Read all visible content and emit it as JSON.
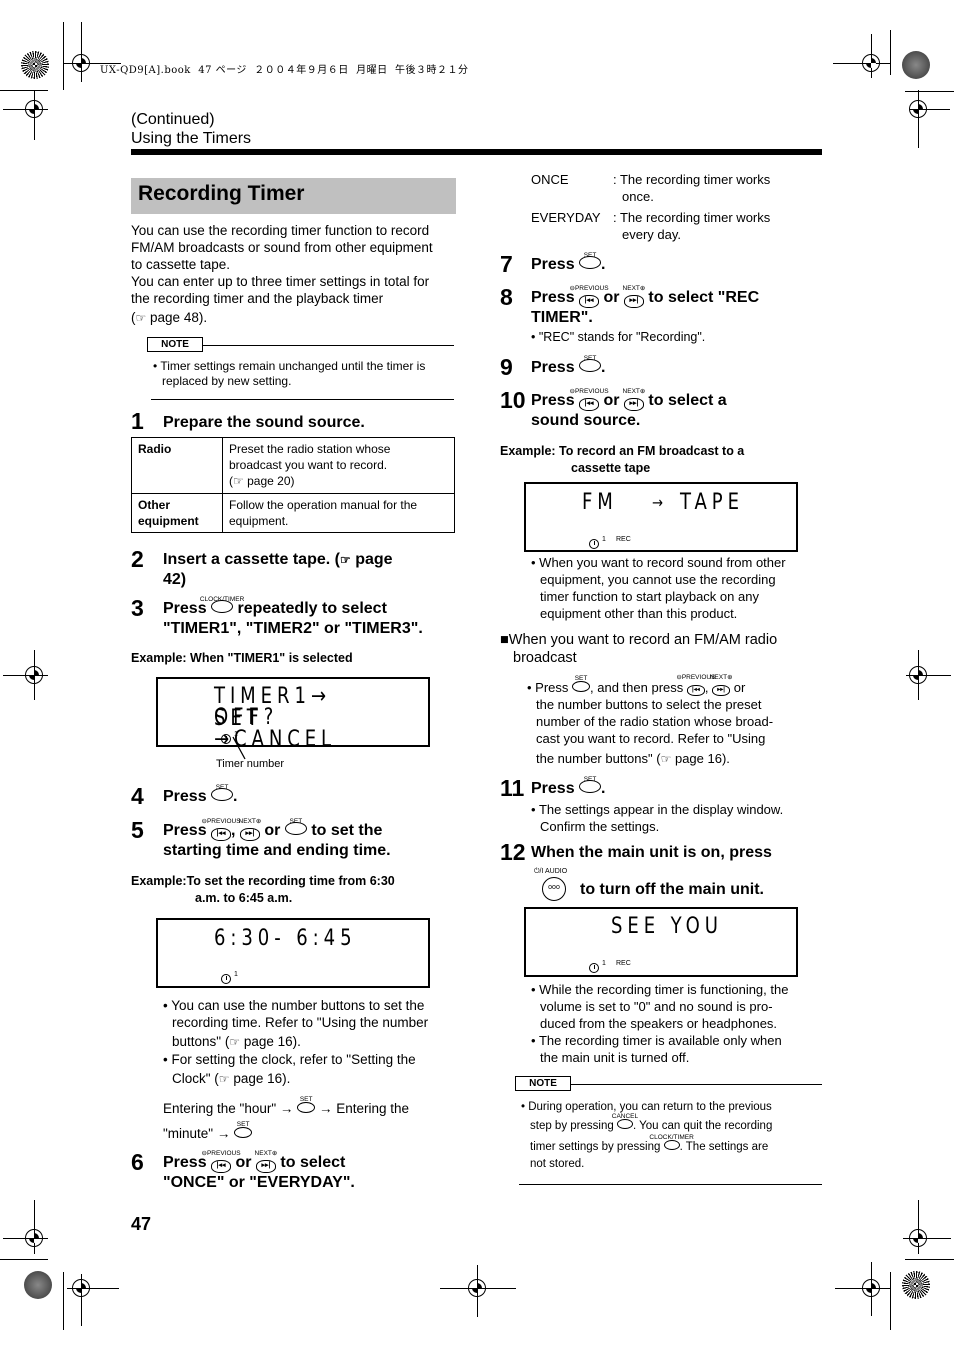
{
  "print_header": "UX-QD9[A].book  47 ページ  ２００４年９月６日  月曜日  午後３時２１分",
  "breadcrumb": {
    "continued": "(Continued)",
    "section": "Using the Timers"
  },
  "section_title": "Recording Timer",
  "intro": {
    "line1": "You can use the recording timer function to record",
    "line2": "FM/AM broadcasts or sound from other equipment",
    "line3": "to cassette tape.",
    "line4": "You can enter up to three timer settings in total for",
    "line5": "the recording timer and the playback timer",
    "ref": "page 48)."
  },
  "note1": {
    "label": "NOTE",
    "line1": "Timer settings remain unchanged until the timer is",
    "line2": "replaced by new setting."
  },
  "icons": {
    "ref": "☞",
    "bullet": "•",
    "arrow": "→",
    "square": "■",
    "prev": "|◂◂",
    "next": "▸▸|"
  },
  "buttons": {
    "set": "SET",
    "clock_timer": "CLOCK/TIMER",
    "previous": "⊖PREVIOUS",
    "next": "NEXT⊕",
    "cancel": "CANCEL",
    "audio": "⏻/I AUDIO"
  },
  "steps": {
    "s1": {
      "num": "1",
      "text": "Prepare the sound source."
    },
    "s2": {
      "num": "2",
      "text": "Insert a cassette tape. (",
      "ref": "page",
      "text2": "42)"
    },
    "s3": {
      "num": "3",
      "press": "Press",
      "text": "repeatedly to select",
      "text2": "\"TIMER1\", \"TIMER2\" or \"TIMER3\"."
    },
    "s4": {
      "num": "4",
      "press": "Press",
      "end": "."
    },
    "s5": {
      "num": "5",
      "press": "Press",
      "comma": ",",
      "or": "or",
      "text": "to set the",
      "text2": "starting time and ending time."
    },
    "s6": {
      "num": "6",
      "press": "Press",
      "or": "or",
      "text": "to select",
      "text2": "\"ONCE\" or \"EVERYDAY\"."
    },
    "s7": {
      "num": "7",
      "press": "Press",
      "end": "."
    },
    "s8": {
      "num": "8",
      "press": "Press",
      "or": "or",
      "text": "to select \"REC",
      "text2": "TIMER\".",
      "note": "\"REC\" stands for \"Recording\"."
    },
    "s9": {
      "num": "9",
      "press": "Press",
      "end": "."
    },
    "s10": {
      "num": "10",
      "press": "Press",
      "or": "or",
      "text": "to select a",
      "text2": "sound source."
    },
    "s11": {
      "num": "11",
      "press": "Press",
      "end": ".",
      "note1": "The settings appear in the display window.",
      "note2": "Confirm the settings."
    },
    "s12": {
      "num": "12",
      "text": "When the main unit is on, press",
      "text2": "to turn off the main unit."
    }
  },
  "source_table": {
    "rows": [
      {
        "label": "Radio",
        "desc1": "Preset the radio station whose",
        "desc2": "broadcast you want to record.",
        "ref": "page 20)"
      },
      {
        "label1": "Other",
        "label2": "equipment",
        "desc1": "Follow the operation manual for the",
        "desc2": "equipment."
      }
    ]
  },
  "example1": {
    "caption": "Example: When \"TIMER1\" is selected",
    "lcd_line1": "TIMER1→ SET",
    "lcd_line2": "OFF?→CANCEL",
    "timer_num": "1",
    "callout": "Timer number"
  },
  "example2": {
    "caption1": "Example:To set the recording time from 6:30",
    "caption2": "a.m. to 6:45 a.m.",
    "lcd_line1": "6:30- 6:45",
    "timer_num": "1"
  },
  "tips5": {
    "b1_l1": "You can use the number buttons to set the",
    "b1_l2": "recording time. Refer to \"Using the number",
    "b1_l3": "buttons\" (",
    "b1_ref": "page 16).",
    "b2_l1": "For setting the clock, refer to \"Setting the",
    "b2_l2": "Clock\" (",
    "b2_ref": "page 16).",
    "flow1": "Entering the \"hour\" →",
    "flow2": "→ Entering the",
    "flow3": "\"minute\" →"
  },
  "modes": [
    {
      "name": "ONCE",
      "desc1": ": The recording timer works",
      "desc2": "once."
    },
    {
      "name": "EVERYDAY",
      "desc1": ": The recording timer works",
      "desc2": "every day."
    }
  ],
  "example3": {
    "caption1": "Example: To record an FM broadcast to a",
    "caption2": "cassette tape",
    "lcd_left": "FM",
    "lcd_arrow": "→",
    "lcd_right": "TAPE",
    "timer_num": "1",
    "rec": "REC",
    "note_l1": "When you want to record sound from other",
    "note_l2": "equipment, you cannot use the recording",
    "note_l3": "timer function to start playback on any",
    "note_l4": "equipment other than this product."
  },
  "radio_section": {
    "heading1": "When you want to record an FM/AM radio",
    "heading2": "broadcast",
    "press": "Press",
    "then": ", and then press",
    "comma": ",",
    "or": "or",
    "l2": "the number buttons to select the preset",
    "l3": "number of the radio station whose broad-",
    "l4": "cast you want to record. Refer to \"Using",
    "l5": "the number buttons\" (",
    "ref": "page 16)."
  },
  "example4": {
    "lcd": "SEE YOU",
    "timer_num": "1",
    "rec": "REC",
    "b1_l1": "While the recording timer is functioning, the",
    "b1_l2": "volume is set to \"0\" and no sound is pro-",
    "b1_l3": "duced from the speakers or headphones.",
    "b2_l1": "The recording timer is available only when",
    "b2_l2": "the main unit is turned off."
  },
  "note2": {
    "label": "NOTE",
    "l1": "During operation, you can return to the previous",
    "l2a": "step by pressing",
    "l2b": ". You can quit the recording",
    "l3a": "timer settings by pressing",
    "l3b": ". The settings are",
    "l4": "not stored."
  },
  "page_number": "47"
}
